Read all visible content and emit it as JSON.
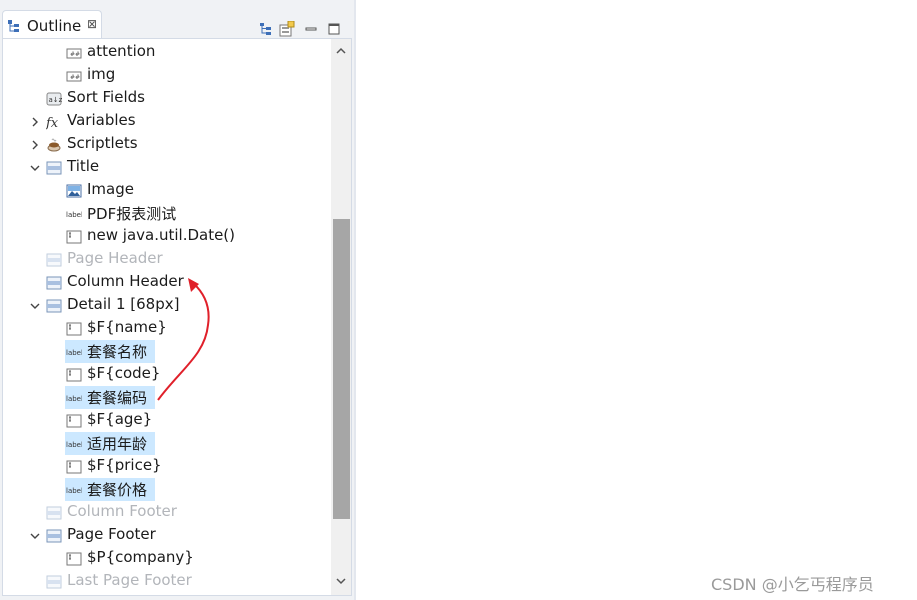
{
  "panel": {
    "tab_label": "Outline",
    "tab_close": "⊠"
  },
  "tree": [
    {
      "label": "attention",
      "icon": "field-icon",
      "expand": "none",
      "dim": false,
      "highlight": false
    },
    {
      "label": "img",
      "icon": "field-icon",
      "expand": "none",
      "dim": false,
      "highlight": false
    },
    {
      "label": "Sort Fields",
      "icon": "sort-fields-icon",
      "expand": "none",
      "dim": false,
      "highlight": false
    },
    {
      "label": "Variables",
      "icon": "function-icon",
      "expand": "collapsed",
      "dim": false,
      "highlight": false
    },
    {
      "label": "Scriptlets",
      "icon": "coffee-cup-icon",
      "expand": "collapsed",
      "dim": false,
      "highlight": false
    },
    {
      "label": "Title",
      "icon": "band-icon",
      "expand": "expanded",
      "dim": false,
      "highlight": false
    },
    {
      "label": "Image",
      "icon": "image-icon",
      "expand": "none",
      "dim": false,
      "highlight": false
    },
    {
      "label": "PDF报表测试",
      "icon": "static-label-icon",
      "expand": "none",
      "dim": false,
      "highlight": false
    },
    {
      "label": "new java.util.Date()",
      "icon": "textfield-icon",
      "expand": "none",
      "dim": false,
      "highlight": false
    },
    {
      "label": "Page Header",
      "icon": "band-icon",
      "expand": "none",
      "dim": true,
      "highlight": false
    },
    {
      "label": "Column Header",
      "icon": "band-icon",
      "expand": "none",
      "dim": false,
      "highlight": false
    },
    {
      "label": "Detail 1 [68px]",
      "icon": "band-icon",
      "expand": "expanded",
      "dim": false,
      "highlight": false
    },
    {
      "label": "$F{name}",
      "icon": "textfield-icon",
      "expand": "none",
      "dim": false,
      "highlight": false
    },
    {
      "label": "套餐名称",
      "icon": "static-label-icon",
      "expand": "none",
      "dim": false,
      "highlight": true
    },
    {
      "label": "$F{code}",
      "icon": "textfield-icon",
      "expand": "none",
      "dim": false,
      "highlight": false
    },
    {
      "label": "套餐编码",
      "icon": "static-label-icon",
      "expand": "none",
      "dim": false,
      "highlight": true
    },
    {
      "label": "$F{age}",
      "icon": "textfield-icon",
      "expand": "none",
      "dim": false,
      "highlight": false
    },
    {
      "label": "适用年龄",
      "icon": "static-label-icon",
      "expand": "none",
      "dim": false,
      "highlight": true
    },
    {
      "label": "$F{price}",
      "icon": "textfield-icon",
      "expand": "none",
      "dim": false,
      "highlight": false
    },
    {
      "label": "套餐价格",
      "icon": "static-label-icon",
      "expand": "none",
      "dim": false,
      "highlight": true
    },
    {
      "label": "Column Footer",
      "icon": "band-icon",
      "expand": "none",
      "dim": true,
      "highlight": false
    },
    {
      "label": "Page Footer",
      "icon": "band-icon",
      "expand": "expanded",
      "dim": false,
      "highlight": false
    },
    {
      "label": "$P{company}",
      "icon": "textfield-icon",
      "expand": "none",
      "dim": false,
      "highlight": false
    },
    {
      "label": "Last Page Footer",
      "icon": "band-icon",
      "expand": "none",
      "dim": true,
      "highlight": false
    }
  ],
  "watermark": "CSDN @小乞丐程序员",
  "colors": {
    "highlight": "#cce8ff",
    "annotation_arrow": "#e0202a",
    "dim_text": "#b2b5ba"
  }
}
